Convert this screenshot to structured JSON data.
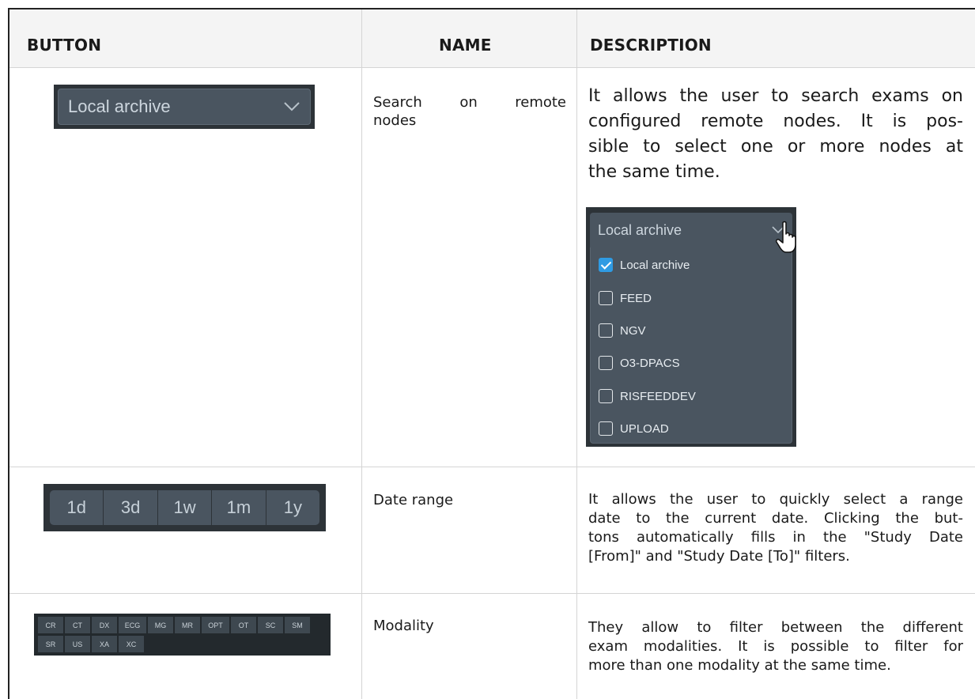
{
  "headers": {
    "button": "BUTTON",
    "name": "NAME",
    "description": "DESCRIPTION"
  },
  "rows": [
    {
      "name_lines": [
        "Search on remote",
        "nodes"
      ],
      "desc_lines": [
        "It allows the user to search exams on",
        "configured remote nodes. It is pos-",
        "sible to select one or more nodes at",
        "the same time."
      ],
      "widget": {
        "selected_label": "Local archive"
      },
      "popup": {
        "selected_label": "Local archive",
        "options": [
          {
            "label": "Local archive",
            "checked": true
          },
          {
            "label": "FEED",
            "checked": false
          },
          {
            "label": "NGV",
            "checked": false
          },
          {
            "label": "O3-DPACS",
            "checked": false
          },
          {
            "label": "RISFEEDDEV",
            "checked": false
          },
          {
            "label": "UPLOAD",
            "checked": false
          }
        ]
      }
    },
    {
      "name_lines": [
        "Date range"
      ],
      "desc_lines": [
        "It allows the user to quickly select a range",
        "date to the current date. Clicking the but-",
        "tons automatically fills in the \"Study Date",
        "[From]\" and \"Study Date [To]\" filters."
      ],
      "buttons": [
        "1d",
        "3d",
        "1w",
        "1m",
        "1y"
      ]
    },
    {
      "name_lines": [
        "Modality"
      ],
      "desc_lines": [
        "They allow to filter between the different",
        "exam modalities. It is possible to filter for",
        "more than one modality at the same time."
      ],
      "modalities_row1": [
        "CR",
        "CT",
        "DX",
        "ECG",
        "MG",
        "MR",
        "OPT",
        "OT",
        "SC",
        "SM"
      ],
      "modalities_row2": [
        "SR",
        "US",
        "XA",
        "XC"
      ]
    }
  ],
  "colors": {
    "widget_dark": "#2d3338",
    "widget_mid": "#4a5560",
    "checkbox_on": "#2f9be3"
  }
}
